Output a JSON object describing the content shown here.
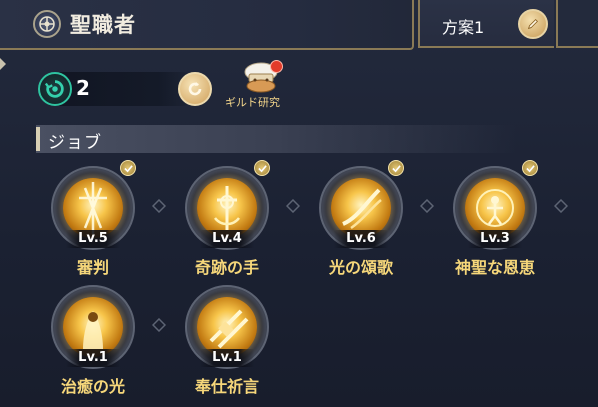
{
  "header": {
    "title": "聖職者",
    "class_icon": "holy-emblem-icon"
  },
  "plan": {
    "label": "方案1",
    "edit_icon": "pencil-icon"
  },
  "points": {
    "value": "2",
    "icon": "skill-point-icon",
    "reset_icon": "reset-icon"
  },
  "guild": {
    "label": "ギルド研究",
    "icon": "guild-chef-icon"
  },
  "section": {
    "label": "ジョブ"
  },
  "skills": [
    {
      "level": "Lv.5",
      "name": "審判",
      "checked": true
    },
    {
      "level": "Lv.4",
      "name": "奇跡の手",
      "checked": true
    },
    {
      "level": "Lv.6",
      "name": "光の頌歌",
      "checked": true
    },
    {
      "level": "Lv.3",
      "name": "神聖な恩恵",
      "checked": true
    },
    {
      "level": "Lv.1",
      "name": "治癒の光",
      "checked": false
    },
    {
      "level": "Lv.1",
      "name": "奉仕祈言",
      "checked": false
    }
  ],
  "colors": {
    "accent_gold": "#f6d77a",
    "frame": "#8a7a56",
    "points_ring": "#2fc3a0",
    "badge_red": "#e23b2a"
  }
}
